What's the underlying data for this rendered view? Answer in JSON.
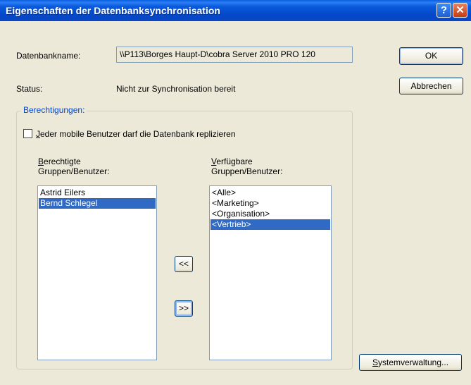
{
  "window": {
    "title": "Eigenschaften der Datenbanksynchronisation",
    "help_glyph": "?",
    "close_glyph": "✕"
  },
  "database": {
    "name_label": "Datenbankname:",
    "name_value": "\\\\P113\\Borges Haupt-D\\cobra Server 2010 PRO 120",
    "status_label": "Status:",
    "status_value": "Nicht zur Synchronisation bereit"
  },
  "buttons": {
    "ok": "OK",
    "cancel": "Abbrechen",
    "move_left": "<<",
    "move_right": ">>",
    "system_admin_mnemonic": "S",
    "system_admin_rest": "ystemverwaltung..."
  },
  "permissions": {
    "group_title": "Berechtigungen:",
    "checkbox_mnemonic": "J",
    "checkbox_rest": "eder mobile Benutzer darf die Datenbank replizieren",
    "checkbox_checked": false,
    "authorized_header_mnemonic": "B",
    "authorized_header_line1_rest": "erechtigte",
    "authorized_header_line2": "Gruppen/Benutzer:",
    "available_header_mnemonic": "V",
    "available_header_line1_rest": "erfügbare",
    "available_header_line2": "Gruppen/Benutzer:",
    "authorized": [
      {
        "label": "Astrid Eilers",
        "selected": false
      },
      {
        "label": "Bernd Schlegel",
        "selected": true
      }
    ],
    "available": [
      {
        "label": "<Alle>",
        "selected": false
      },
      {
        "label": "<Marketing>",
        "selected": false
      },
      {
        "label": "<Organisation>",
        "selected": false
      },
      {
        "label": "<Vertrieb>",
        "selected": true
      }
    ]
  },
  "colors": {
    "title_bar": "#0a5adc",
    "selection": "#316ac5",
    "group_title": "#0046d5",
    "face": "#ece9d8"
  }
}
